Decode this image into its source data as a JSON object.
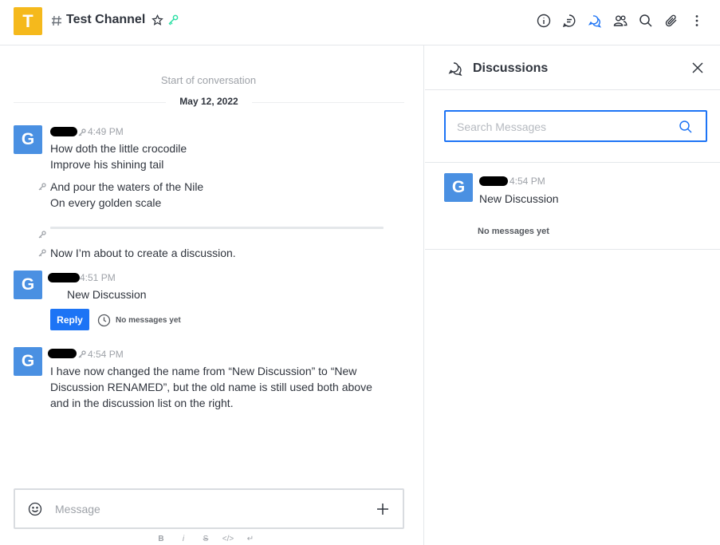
{
  "header": {
    "avatar_letter": "T",
    "channel_name": "Test Channel",
    "toolbar": [
      "info-icon",
      "threads-icon",
      "discussions-icon",
      "members-icon",
      "search-icon",
      "attachment-icon",
      "kebab-menu-icon"
    ]
  },
  "main": {
    "start_label": "Start of conversation",
    "date_label": "May 12, 2022",
    "messages": [
      {
        "avatar": "G",
        "time": "4:49 PM",
        "blocks": [
          [
            "How doth the little crocodile",
            "Improve his shining tail"
          ],
          [
            "And pour the waters of the Nile",
            "On every golden scale"
          ],
          [
            ""
          ],
          [
            "Now I’m about to create a discussion."
          ]
        ]
      },
      {
        "avatar": "G",
        "time": "4:51 PM",
        "text": "New Discussion",
        "reply_label": "Reply",
        "status": "No messages yet"
      },
      {
        "avatar": "G",
        "time": "4:54 PM",
        "lines": [
          "I have now changed the name from “New Discussion” to “New",
          "Discussion RENAMED”, but the old name is still used both above",
          "and in the discussion list on the right."
        ]
      }
    ],
    "composer": {
      "placeholder": "Message",
      "format_buttons": [
        "B",
        "i",
        "S",
        "</>",
        "↵"
      ]
    }
  },
  "panel": {
    "title": "Discussions",
    "search_placeholder": "Search Messages",
    "items": [
      {
        "avatar": "G",
        "time": "4:54 PM",
        "name": "New Discussion",
        "status": "No messages yet"
      }
    ]
  },
  "colors": {
    "channel_avatar": "#f5b91c",
    "user_avatar": "#4a90e2",
    "accent": "#1d74f5"
  }
}
